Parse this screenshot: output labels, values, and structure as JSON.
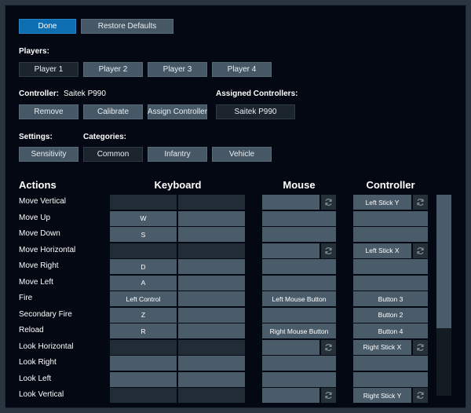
{
  "top": {
    "done": "Done",
    "restore": "Restore Defaults"
  },
  "players": {
    "label": "Players:",
    "items": [
      "Player 1",
      "Player 2",
      "Player 3",
      "Player 4"
    ],
    "selected": 0
  },
  "controller": {
    "label": "Controller:",
    "name": "Saitek P990",
    "remove": "Remove",
    "calibrate": "Calibrate",
    "assign": "Assign Controller"
  },
  "assigned": {
    "label": "Assigned Controllers:",
    "items": [
      "Saitek P990"
    ]
  },
  "settings": {
    "label": "Settings:",
    "sensitivity": "Sensitivity"
  },
  "categories": {
    "label": "Categories:",
    "items": [
      "Common",
      "Infantry",
      "Vehicle"
    ],
    "selected": 0
  },
  "headers": {
    "actions": "Actions",
    "keyboard": "Keyboard",
    "mouse": "Mouse",
    "controller": "Controller"
  },
  "colors": {
    "accent": "#0d6fb2",
    "button": "#465866",
    "cell": "#4a5c6a",
    "cell_dark": "#222c36",
    "background": "#040812"
  },
  "rows": [
    {
      "action": "Move Vertical",
      "kb1": "",
      "kb2": "",
      "mouse": "",
      "ctrl": "Left Stick Y",
      "axis": true
    },
    {
      "action": "Move Up",
      "kb1": "W",
      "kb2": "",
      "mouse": "",
      "ctrl": "",
      "axis": false
    },
    {
      "action": "Move Down",
      "kb1": "S",
      "kb2": "",
      "mouse": "",
      "ctrl": "",
      "axis": false
    },
    {
      "action": "Move Horizontal",
      "kb1": "",
      "kb2": "",
      "mouse": "",
      "ctrl": "Left Stick X",
      "axis": true
    },
    {
      "action": "Move Right",
      "kb1": "D",
      "kb2": "",
      "mouse": "",
      "ctrl": "",
      "axis": false
    },
    {
      "action": "Move Left",
      "kb1": "A",
      "kb2": "",
      "mouse": "",
      "ctrl": "",
      "axis": false
    },
    {
      "action": "Fire",
      "kb1": "Left Control",
      "kb2": "",
      "mouse": "Left Mouse Button",
      "ctrl": "Button 3",
      "axis": false
    },
    {
      "action": "Secondary Fire",
      "kb1": "Z",
      "kb2": "",
      "mouse": "",
      "ctrl": "Button 2",
      "axis": false
    },
    {
      "action": "Reload",
      "kb1": "R",
      "kb2": "",
      "mouse": "Right Mouse Button",
      "ctrl": "Button 4",
      "axis": false
    },
    {
      "action": "Look Horizontal",
      "kb1": "",
      "kb2": "",
      "mouse": "",
      "ctrl": "Right Stick X",
      "axis": true
    },
    {
      "action": "Look Right",
      "kb1": "",
      "kb2": "",
      "mouse": "",
      "ctrl": "",
      "axis": false
    },
    {
      "action": "Look Left",
      "kb1": "",
      "kb2": "",
      "mouse": "",
      "ctrl": "",
      "axis": false
    },
    {
      "action": "Look Vertical",
      "kb1": "",
      "kb2": "",
      "mouse": "",
      "ctrl": "Right Stick Y",
      "axis": true
    }
  ],
  "icons": {
    "axis_reset": "refresh-icon"
  }
}
